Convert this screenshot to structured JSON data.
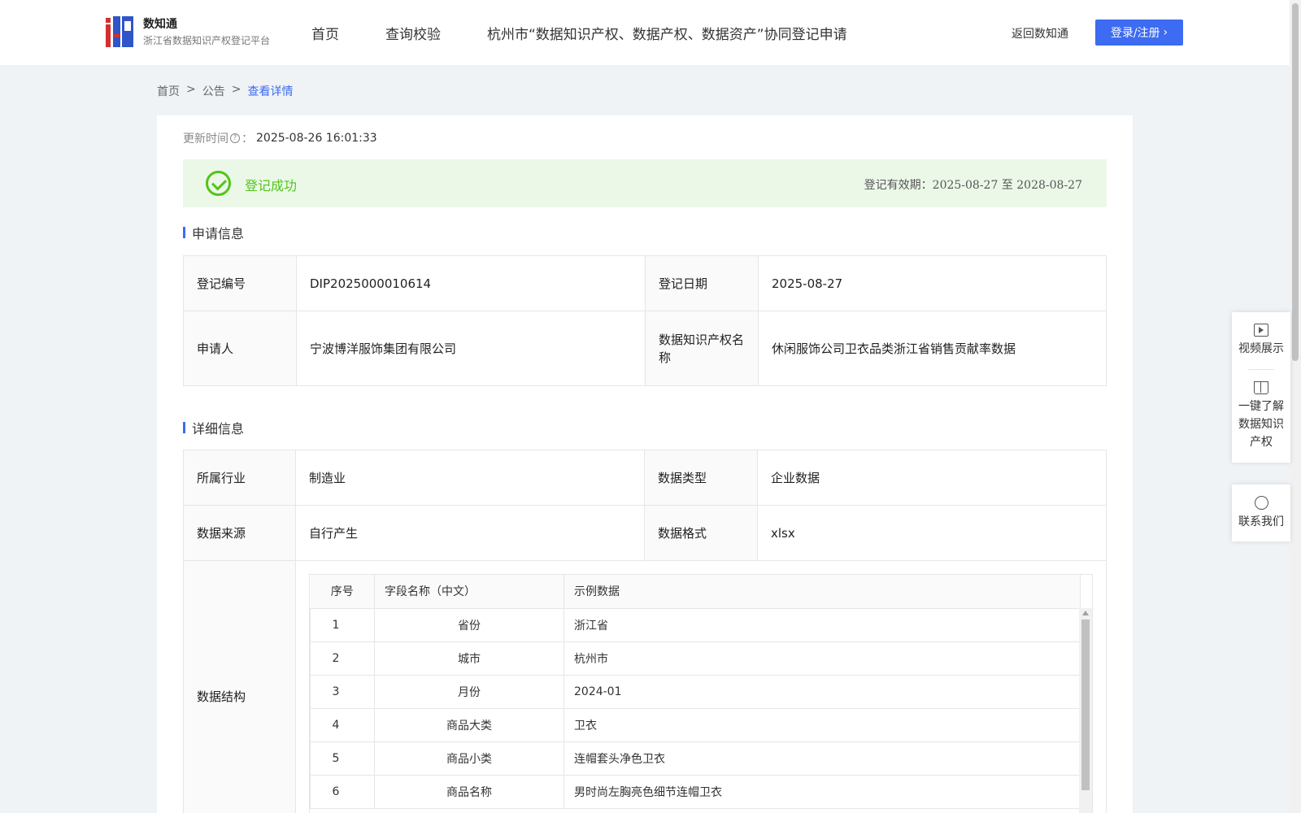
{
  "header": {
    "logo_title": "数知通",
    "logo_subtitle": "浙江省数据知识产权登记平台",
    "nav": [
      "首页",
      "查询校验",
      "杭州市“数据知识产权、数据产权、数据资产”协同登记申请"
    ],
    "back_link": "返回数知通",
    "login": "登录/注册",
    "login_chevron": "›"
  },
  "breadcrumb": {
    "items": [
      "首页",
      "公告",
      "查看详情"
    ],
    "sep": ">"
  },
  "update": {
    "label": "更新时间",
    "help": "?",
    "colon": "：",
    "value": "2025-08-26 16:01:33"
  },
  "status": {
    "text": "登记成功",
    "valid": "登记有效期：2025-08-27 至 2028-08-27",
    "color": "#52c41a"
  },
  "apply": {
    "title": "申请信息",
    "reg_no_label": "登记编号",
    "reg_no": "DIP2025000010614",
    "reg_date_label": "登记日期",
    "reg_date": "2025-08-27",
    "applicant_label": "申请人",
    "applicant": "宁波博洋服饰集团有限公司",
    "ip_name_label": "数据知识产权名称",
    "ip_name": "休闲服饰公司卫衣品类浙江省销售贡献率数据"
  },
  "detail": {
    "title": "详细信息",
    "industry_label": "所属行业",
    "industry": "制造业",
    "data_type_label": "数据类型",
    "data_type": "企业数据",
    "source_label": "数据来源",
    "source": "自行产生",
    "format_label": "数据格式",
    "format": "xlsx",
    "structure_label": "数据结构",
    "structure": {
      "headers": [
        "序号",
        "字段名称（中文）",
        "示例数据"
      ],
      "rows": [
        [
          "1",
          "省份",
          "浙江省"
        ],
        [
          "2",
          "城市",
          "杭州市"
        ],
        [
          "3",
          "月份",
          "2024-01"
        ],
        [
          "4",
          "商品大类",
          "卫衣"
        ],
        [
          "5",
          "商品小类",
          "连帽套头净色卫衣"
        ],
        [
          "6",
          "商品名称",
          "男时尚左胸亮色细节连帽卫衣"
        ]
      ]
    }
  },
  "float": {
    "video": "视频展示",
    "learn": "一键了解数据知识产权",
    "contact": "联系我们"
  },
  "colors": {
    "accent": "#3d6bf1",
    "success_bg": "#ebf8e8"
  }
}
